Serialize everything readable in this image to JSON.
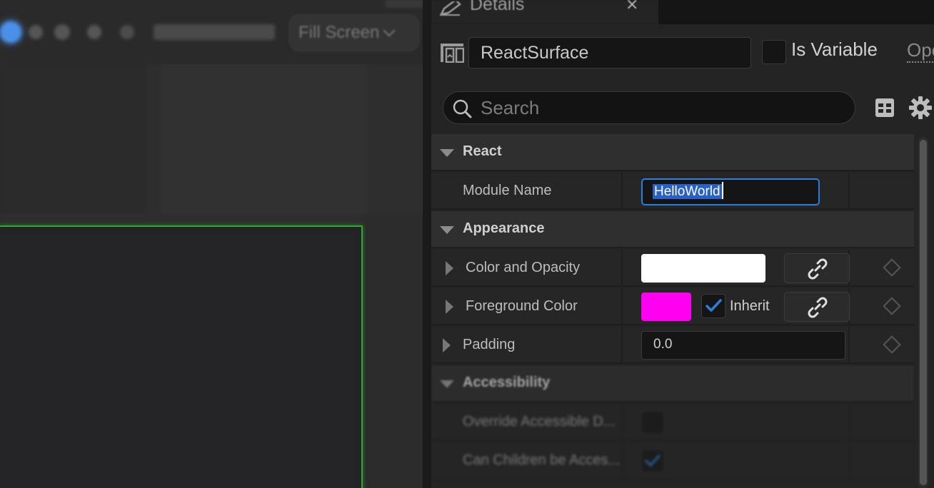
{
  "viewport": {
    "zoom_mode": "Fill Screen"
  },
  "details_tab": {
    "title": "Details",
    "close_glyph": "×"
  },
  "widget": {
    "name": "ReactSurface",
    "is_variable_label": "Is Variable",
    "is_variable_checked": false,
    "open_label": "Open"
  },
  "search": {
    "placeholder": "Search",
    "value": ""
  },
  "categories": {
    "react": "React",
    "appearance": "Appearance",
    "accessibility": "Accessibility"
  },
  "properties": {
    "module_name": {
      "label": "Module Name",
      "value": "HelloWorld"
    },
    "color_and_opacity": {
      "label": "Color and Opacity",
      "color": "#ffffff"
    },
    "foreground_color": {
      "label": "Foreground Color",
      "color": "#ff00f0",
      "inherit_label": "Inherit",
      "inherit_checked": true
    },
    "padding": {
      "label": "Padding",
      "value": "0.0"
    },
    "override_accessible": {
      "label": "Override Accessible D...",
      "checked": false
    },
    "can_children": {
      "label": "Can Children be Acces...",
      "checked": true
    }
  },
  "icons": {
    "details_tab": "pencil-icon",
    "widget": "widget-icon",
    "search": "search-icon",
    "table": "table-icon",
    "settings": "gear-icon",
    "link": "link-icon",
    "keyframe": "diamond-icon",
    "check": "checkmark-icon"
  },
  "colors": {
    "accent": "#2a7fd9",
    "selection_outline": "#2ea82e"
  }
}
